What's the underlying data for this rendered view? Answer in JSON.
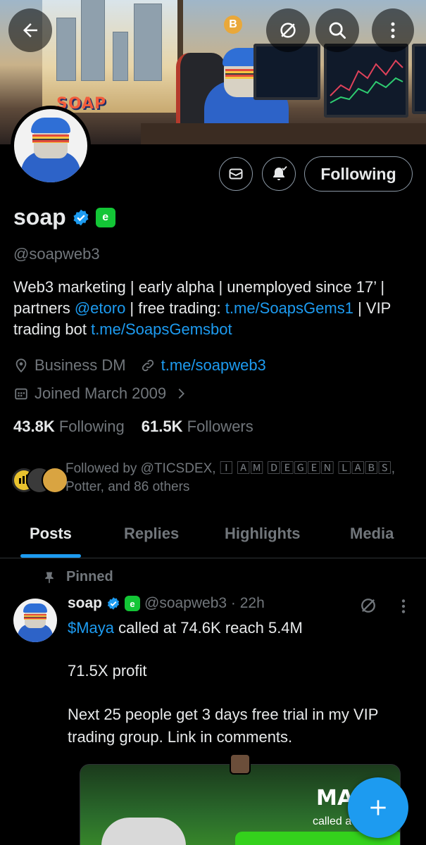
{
  "header": {
    "back_icon": "arrow-left-icon",
    "icons": [
      "grok-icon",
      "search-icon",
      "more-vertical-icon"
    ]
  },
  "banner": {
    "sign_text": "SOAP",
    "coin_text": "B"
  },
  "actions": {
    "message_icon": "envelope-icon",
    "notify_icon": "bell-check-icon",
    "following_label": "Following"
  },
  "profile": {
    "name": "soap",
    "etoro_badge": "e",
    "handle": "@soapweb3",
    "bio_1": "Web3 marketing | early alpha | unemployed since 17’ |",
    "bio_2a": "partners ",
    "bio_2b": "@etoro",
    "bio_2c": " | free trading: ",
    "bio_2d": "t.me/SoapsGems1",
    "bio_2e": " | VIP",
    "bio_3a": "trading bot ",
    "bio_3b": "t.me/SoapsGemsbot",
    "category": "Business DM",
    "website": "t.me/soapweb3",
    "joined": "Joined March 2009",
    "following_count": "43.8K",
    "following_label": "Following",
    "followers_count": "61.5K",
    "followers_label": "Followers",
    "followed_by_1": "Followed by @TICSDEX, 🄸 🄰🄼 🄳🄴🄶🄴🄽 🄻🄰🄱🅂,",
    "followed_by_2": "Potter, and 86 others"
  },
  "tabs": [
    {
      "label": "Posts",
      "active": true
    },
    {
      "label": "Replies",
      "active": false
    },
    {
      "label": "Highlights",
      "active": false
    },
    {
      "label": "Media",
      "active": false
    }
  ],
  "post": {
    "pinned_label": "Pinned",
    "author_name": "soap",
    "etoro_badge": "e",
    "author_handle": "@soapweb3 · 22h",
    "line1_link": "$Maya",
    "line1_text": " called at 74.6K reach 5.4M",
    "line2": "71.5X profit",
    "line3": "Next 25 people get 3 days free trial in my VIP",
    "line4": "trading group. Link in comments.",
    "media_title": "MA",
    "media_subtitle": "called a"
  },
  "fab": {
    "icon": "plus-icon"
  },
  "colors": {
    "background": "#000000",
    "text": "#e7e9ea",
    "muted": "#71767b",
    "accent": "#1d9bf0",
    "etoro_green": "#13c636"
  }
}
